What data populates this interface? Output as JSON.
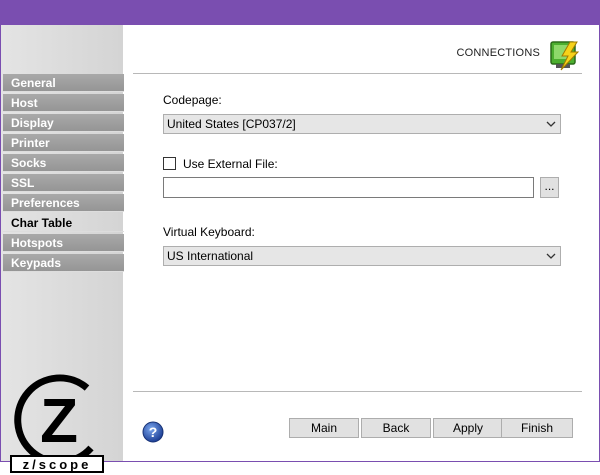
{
  "header": {
    "title": "CONNECTIONS",
    "icon": "connections-icon"
  },
  "sidebar": {
    "items": [
      {
        "label": "General",
        "active": false
      },
      {
        "label": "Host",
        "active": false
      },
      {
        "label": "Display",
        "active": false
      },
      {
        "label": "Printer",
        "active": false
      },
      {
        "label": "Socks",
        "active": false
      },
      {
        "label": "SSL",
        "active": false
      },
      {
        "label": "Preferences",
        "active": false
      },
      {
        "label": "Char Table",
        "active": true
      },
      {
        "label": "Hotspots",
        "active": false
      },
      {
        "label": "Keypads",
        "active": false
      }
    ],
    "logo_text": "z/scope",
    "logo_letter": "Z",
    "logo_wordmark": "z/scope"
  },
  "form": {
    "codepage_label": "Codepage:",
    "codepage_value": "United States [CP037/2]",
    "external_file_label": "Use External File:",
    "external_file_checked": false,
    "external_file_value": "",
    "browse_label": "...",
    "keyboard_label": "Virtual Keyboard:",
    "keyboard_value": "US International"
  },
  "buttons": {
    "main": "Main",
    "back": "Back",
    "apply": "Apply",
    "finish": "Finish"
  },
  "colors": {
    "titlebar": "#7a4eb0",
    "nav_bg": "#a0a0a0",
    "accent": "#2a4fa8"
  }
}
